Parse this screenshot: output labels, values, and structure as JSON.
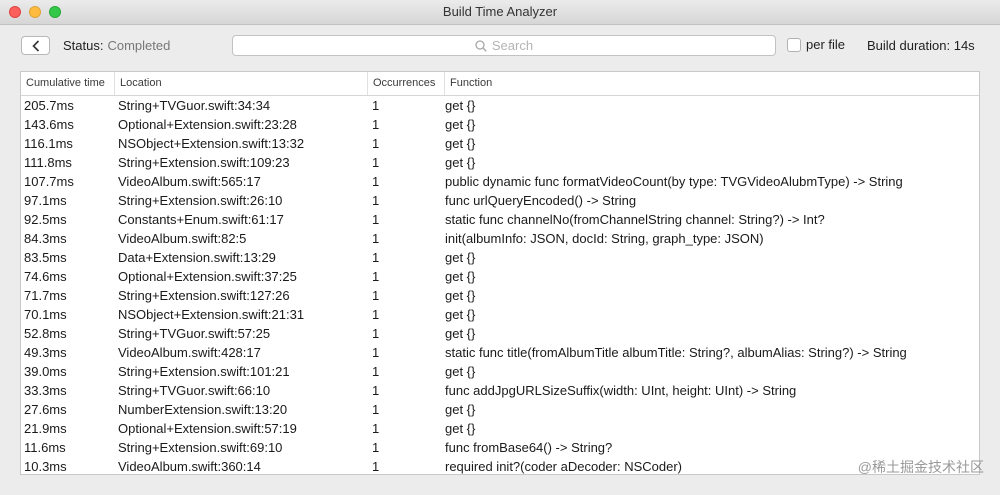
{
  "window": {
    "title": "Build Time Analyzer"
  },
  "toolbar": {
    "status_label": "Status:",
    "status_value": "Completed",
    "search_placeholder": "Search",
    "per_file_label": "per file",
    "build_duration": "Build duration: 14s"
  },
  "table": {
    "headers": [
      "Cumulative time",
      "Location",
      "Occurrences",
      "Function"
    ],
    "rows": [
      {
        "time": "205.7ms",
        "location": "String+TVGuor.swift:34:34",
        "occ": "1",
        "func": "get {}"
      },
      {
        "time": "143.6ms",
        "location": "Optional+Extension.swift:23:28",
        "occ": "1",
        "func": "get {}"
      },
      {
        "time": "116.1ms",
        "location": "NSObject+Extension.swift:13:32",
        "occ": "1",
        "func": "get {}"
      },
      {
        "time": "111.8ms",
        "location": "String+Extension.swift:109:23",
        "occ": "1",
        "func": "get {}"
      },
      {
        "time": "107.7ms",
        "location": "VideoAlbum.swift:565:17",
        "occ": "1",
        "func": "public dynamic func formatVideoCount(by type: TVGVideoAlubmType) -> String"
      },
      {
        "time": "97.1ms",
        "location": "String+Extension.swift:26:10",
        "occ": "1",
        "func": "func urlQueryEncoded() -> String"
      },
      {
        "time": "92.5ms",
        "location": "Constants+Enum.swift:61:17",
        "occ": "1",
        "func": "static func channelNo(fromChannelString channel: String?) -> Int?"
      },
      {
        "time": "84.3ms",
        "location": "VideoAlbum.swift:82:5",
        "occ": "1",
        "func": "init(albumInfo: JSON, docId: String, graph_type: JSON)"
      },
      {
        "time": "83.5ms",
        "location": "Data+Extension.swift:13:29",
        "occ": "1",
        "func": "get {}"
      },
      {
        "time": "74.6ms",
        "location": "Optional+Extension.swift:37:25",
        "occ": "1",
        "func": "get {}"
      },
      {
        "time": "71.7ms",
        "location": "String+Extension.swift:127:26",
        "occ": "1",
        "func": "get {}"
      },
      {
        "time": "70.1ms",
        "location": "NSObject+Extension.swift:21:31",
        "occ": "1",
        "func": "get {}"
      },
      {
        "time": "52.8ms",
        "location": "String+TVGuor.swift:57:25",
        "occ": "1",
        "func": "get {}"
      },
      {
        "time": "49.3ms",
        "location": "VideoAlbum.swift:428:17",
        "occ": "1",
        "func": "static func title(fromAlbumTitle albumTitle: String?, albumAlias: String?) -> String"
      },
      {
        "time": "39.0ms",
        "location": "String+Extension.swift:101:21",
        "occ": "1",
        "func": "get {}"
      },
      {
        "time": "33.3ms",
        "location": "String+TVGuor.swift:66:10",
        "occ": "1",
        "func": "func addJpgURLSizeSuffix(width: UInt, height: UInt) -> String"
      },
      {
        "time": "27.6ms",
        "location": "NumberExtension.swift:13:20",
        "occ": "1",
        "func": "get {}"
      },
      {
        "time": "21.9ms",
        "location": "Optional+Extension.swift:57:19",
        "occ": "1",
        "func": "get {}"
      },
      {
        "time": "11.6ms",
        "location": "String+Extension.swift:69:10",
        "occ": "1",
        "func": "func fromBase64() -> String?"
      },
      {
        "time": "10.3ms",
        "location": "VideoAlbum.swift:360:14",
        "occ": "1",
        "func": "required init?(coder aDecoder: NSCoder)"
      }
    ]
  },
  "watermark": "@稀土掘金技术社区"
}
